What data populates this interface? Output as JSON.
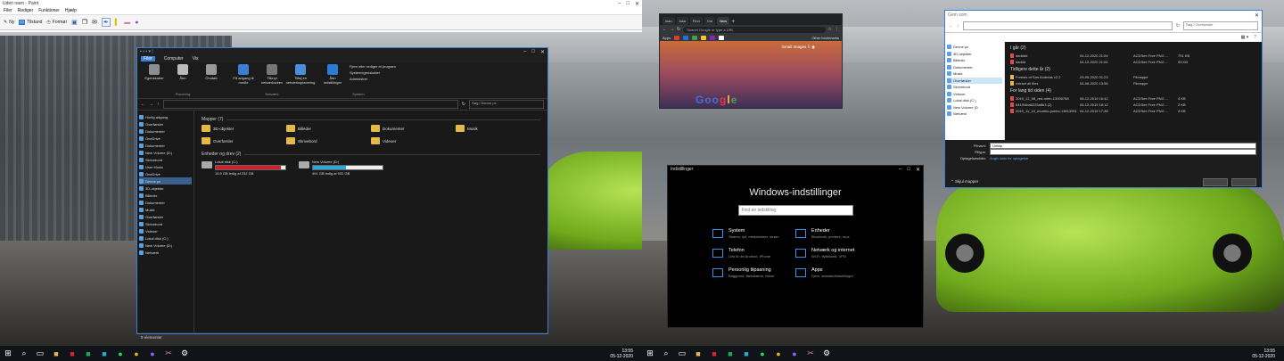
{
  "paint": {
    "title": "Uden navn - Paint",
    "menu": [
      "Filer",
      "Rediger",
      "Funktioner",
      "Hjælp"
    ],
    "toolbar": [
      "Ny",
      "Tilstand",
      "Formør",
      ""
    ]
  },
  "explorer": {
    "tabs": [
      "Filer",
      "Computer",
      "Vis"
    ],
    "ribbon": {
      "buttons": [
        "Egenskaber",
        "Åbn",
        "Omdøb",
        "Få adgang til medie",
        "Tilknyt netværksdrev",
        "Tilføj en netværksplacering",
        "Åbn indstillinger"
      ],
      "side_buttons": [
        "Fjern eller rediger et program",
        "Systemegenskaber",
        "Administrer"
      ],
      "groups": [
        "Placering",
        "Netværk",
        "System"
      ]
    },
    "search_placeholder": "Søg i Denne pc",
    "nav": [
      {
        "label": "Hurtig adgang",
        "selected": false
      },
      {
        "label": "Overførsler",
        "selected": false
      },
      {
        "label": "Dokumenter",
        "selected": false
      },
      {
        "label": "OneDrive",
        "selected": false
      },
      {
        "label": "Dokumenter",
        "selected": false
      },
      {
        "label": "New Volume (D:)",
        "selected": false
      },
      {
        "label": "Skrivebord",
        "selected": false
      },
      {
        "label": "User Music",
        "selected": false
      },
      {
        "label": "OneDrive",
        "selected": false
      },
      {
        "label": "Denne pc",
        "selected": true
      },
      {
        "label": "3D-objekter",
        "selected": false
      },
      {
        "label": "Billeder",
        "selected": false
      },
      {
        "label": "Dokumenter",
        "selected": false
      },
      {
        "label": "Musik",
        "selected": false
      },
      {
        "label": "Overførsler",
        "selected": false
      },
      {
        "label": "Skrivebord",
        "selected": false
      },
      {
        "label": "Videoer",
        "selected": false
      },
      {
        "label": "Lokal disk (C:)",
        "selected": false
      },
      {
        "label": "New Volume (D:)",
        "selected": false
      },
      {
        "label": "Netværk",
        "selected": false
      }
    ],
    "folders_header": "Mapper (7)",
    "folders": [
      "3D-objekter",
      "Billeder",
      "Dokumenter",
      "Musik",
      "Overførsler",
      "Skrivebord",
      "Videoer"
    ],
    "drives_header": "Enheder og drev (2)",
    "drives": [
      {
        "name": "Lokal disk (C:)",
        "info": "15,9 GB ledig af 232 GB",
        "used_fraction": 0.93,
        "color": "#d0212a"
      },
      {
        "name": "New Volume (D:)",
        "info": "491 GB ledig af 931 GB",
        "used_fraction": 0.47,
        "color": "#2aa7d9"
      }
    ],
    "status": "9 elementer"
  },
  "chrome": {
    "tabs": [
      "inan",
      "lobs",
      "Finn",
      "Cre",
      "New"
    ],
    "omnibox_placeholder": "Search Google or type a URL",
    "bookmarks_label": "Apps",
    "other_bookmarks": "Other bookmarks",
    "page_links": [
      "Gmail",
      "Images"
    ]
  },
  "settings": {
    "window_title": "Indstillinger",
    "heading": "Windows-indstillinger",
    "search_placeholder": "Find en indstilling",
    "items": [
      {
        "name": "System",
        "desc": "Skærm, lyd, meddelelser, strøm"
      },
      {
        "name": "Enheder",
        "desc": "Bluetooth, printere, mus"
      },
      {
        "name": "Telefon",
        "desc": "Link til din Android, iPhone"
      },
      {
        "name": "Netværk og internet",
        "desc": "Wi-Fi, flytilstand, VPN"
      },
      {
        "name": "Personlig tilpasning",
        "desc": "Baggrund, låseskærm, farver"
      },
      {
        "name": "Apps",
        "desc": "Fjern, standardindstillinger"
      }
    ]
  },
  "savedlg": {
    "title": "Gem som",
    "search_placeholder": "Søg i Overførsler",
    "nav": [
      {
        "label": "Denne pc",
        "selected": false
      },
      {
        "label": "3D-objekter",
        "selected": false
      },
      {
        "label": "Billeder",
        "selected": false
      },
      {
        "label": "Dokumenter",
        "selected": false
      },
      {
        "label": "Musik",
        "selected": false
      },
      {
        "label": "Overførsler",
        "selected": true
      },
      {
        "label": "Skrivebord",
        "selected": false
      },
      {
        "label": "Videoer",
        "selected": false
      },
      {
        "label": "Lokal disk (C:)",
        "selected": false
      },
      {
        "label": "New Volume (D",
        "selected": false
      },
      {
        "label": "Netværk",
        "selected": false
      }
    ],
    "groups": [
      {
        "header": "I går (2)",
        "files": [
          {
            "name": "dadddd",
            "date": "04-12-2020 21:54",
            "type": "ACDSee Free PNG ...",
            "size": "791 KB",
            "folder": false
          },
          {
            "name": "daddd",
            "date": "04-12-2020 21:51",
            "type": "ACDSee Free PNG ...",
            "size": "93 KB",
            "folder": false
          }
        ]
      },
      {
        "header": "Tidligere dette år (2)",
        "files": [
          {
            "name": "Forests of San Andreas v2.2",
            "date": "29-09-2020 01:23",
            "type": "Filmappe",
            "size": "",
            "folder": true
          },
          {
            "name": "extract all files",
            "date": "04-08-2020 13:56",
            "type": "Filmappe",
            "size": "",
            "folder": true
          }
        ]
      },
      {
        "header": "For lang tid siden (4)",
        "files": [
          {
            "name": "2019_12_08_red-robin-13006768",
            "date": "08-12-2019 16:42",
            "type": "ACDSee Free PNG ...",
            "size": "4 KB",
            "folder": false
          },
          {
            "name": "641f94ba6225a8b3 (2)",
            "date": "05-12-2019 18:12",
            "type": "ACDSee Free PNG ...",
            "size": "2 KB",
            "folder": false
          },
          {
            "name": "2019_11_10_mumbo-jumbo-13613991",
            "date": "04-12-2019 17:38",
            "type": "ACDSee Free PNG ...",
            "size": "4 KB",
            "folder": false
          }
        ]
      }
    ],
    "filename_label": "Filnavn:",
    "filename_value": "Unklip",
    "filetype_label": "Filtype:",
    "tags_label": "Optagelsesdato:",
    "tags_value": "Angiv dato for optagelse",
    "hide_folders": "Skjul mapper"
  },
  "taskbar": {
    "time": "13:55",
    "date": "05-12-2020"
  }
}
